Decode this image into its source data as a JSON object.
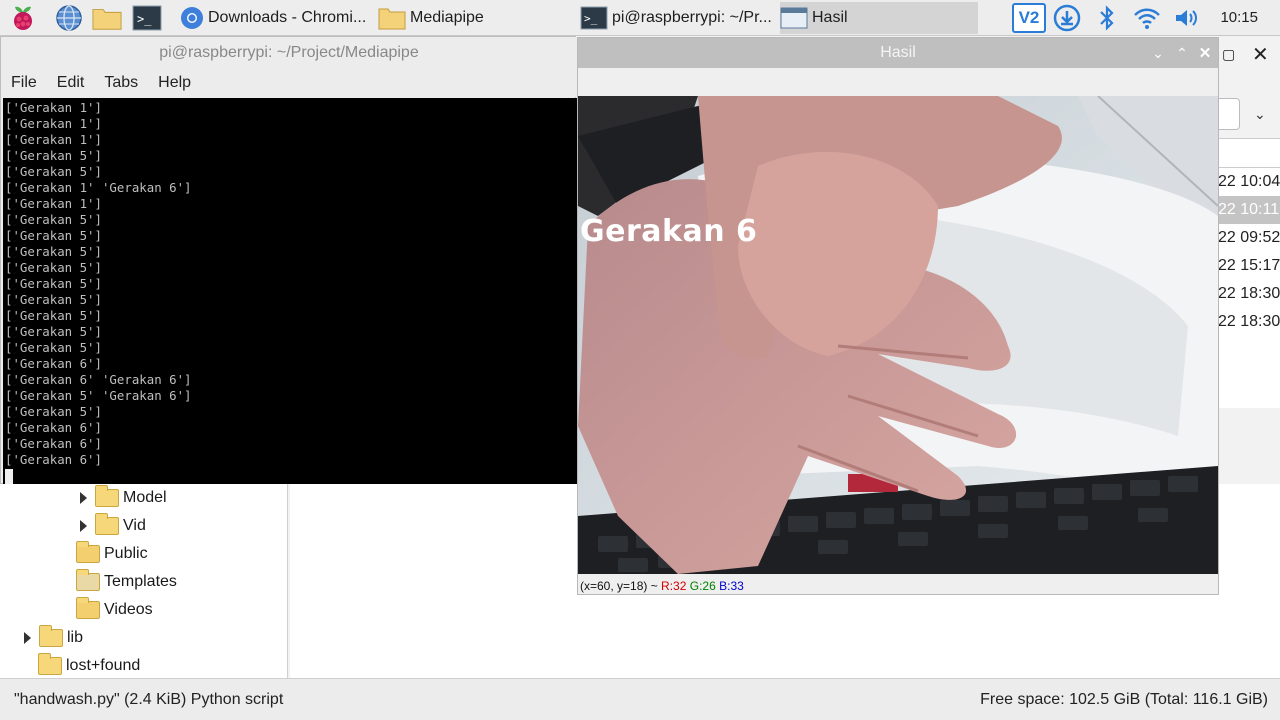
{
  "taskbar": {
    "tasks": [
      {
        "label": "Downloads - Chromi..."
      },
      {
        "label": "Mediapipe"
      },
      {
        "label": "pi@raspberrypi: ~/Pr..."
      },
      {
        "label": "Hasil"
      }
    ],
    "clock": "10:15",
    "colors": {
      "bar": "#ededed",
      "active": "#d4d4d4"
    }
  },
  "terminal": {
    "title": "pi@raspberrypi: ~/Project/Mediapipe",
    "menu": [
      "File",
      "Edit",
      "Tabs",
      "Help"
    ],
    "lines": [
      "['Gerakan 1']",
      "['Gerakan 1']",
      "['Gerakan 1']",
      "['Gerakan 5']",
      "['Gerakan 5']",
      "['Gerakan 1' 'Gerakan 6']",
      "['Gerakan 1']",
      "['Gerakan 5']",
      "['Gerakan 5']",
      "['Gerakan 5']",
      "['Gerakan 5']",
      "['Gerakan 5']",
      "['Gerakan 5']",
      "['Gerakan 5']",
      "['Gerakan 5']",
      "['Gerakan 5']",
      "['Gerakan 6']",
      "['Gerakan 6' 'Gerakan 6']",
      "['Gerakan 5' 'Gerakan 6']",
      "['Gerakan 5']",
      "['Gerakan 6']",
      "['Gerakan 6']",
      "['Gerakan 6']"
    ]
  },
  "hasil": {
    "title": "Hasil",
    "overlay_text": "Gerakan 6",
    "status": {
      "pos": "(x=60, y=18) ~ ",
      "r": "R:32",
      "g": "G:26",
      "b": "B:33"
    }
  },
  "file_manager": {
    "tree": [
      {
        "label": "Model",
        "expandable": true
      },
      {
        "label": "Vid",
        "expandable": true
      },
      {
        "label": "Public",
        "expandable": false
      },
      {
        "label": "Templates",
        "expandable": false
      },
      {
        "label": "Videos",
        "expandable": false
      },
      {
        "label": "lib",
        "expandable": true
      },
      {
        "label": "lost+found",
        "expandable": false
      }
    ],
    "dates": [
      "22 10:04",
      "22 10:11",
      "22 09:52",
      "22 15:17",
      "22 18:30",
      "22 18:30"
    ],
    "status_left": "\"handwash.py\" (2.4 KiB) Python script",
    "status_right": "Free space: 102.5 GiB (Total: 116.1 GiB)"
  }
}
